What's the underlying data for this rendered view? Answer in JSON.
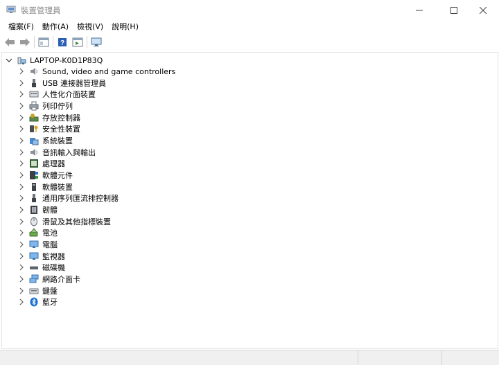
{
  "window": {
    "title": "裝置管理員"
  },
  "menu": [
    "檔案(F)",
    "動作(A)",
    "檢視(V)",
    "說明(H)"
  ],
  "toolbar": {
    "buttons": [
      "back-icon",
      "forward-icon",
      "properties-icon",
      "help-icon",
      "view-icon",
      "monitor-icon"
    ]
  },
  "tree": {
    "root": "LAPTOP-K0D1P83Q",
    "items": [
      {
        "label": "Sound, video and game controllers",
        "icon": "speaker-icon"
      },
      {
        "label": "USB 連接器管理員",
        "icon": "usb-icon"
      },
      {
        "label": "人性化介面裝置",
        "icon": "keyboard-hid-icon"
      },
      {
        "label": "列印佇列",
        "icon": "printer-icon"
      },
      {
        "label": "存放控制器",
        "icon": "storage-controller-icon"
      },
      {
        "label": "安全性裝置",
        "icon": "security-key-icon"
      },
      {
        "label": "系統裝置",
        "icon": "system-folder-icon"
      },
      {
        "label": "音訊輸入與輸出",
        "icon": "audio-icon"
      },
      {
        "label": "處理器",
        "icon": "processor-icon"
      },
      {
        "label": "軟體元件",
        "icon": "software-component-icon"
      },
      {
        "label": "軟體裝置",
        "icon": "software-device-icon"
      },
      {
        "label": "通用序列匯流排控制器",
        "icon": "usb-controller-icon"
      },
      {
        "label": "韌體",
        "icon": "firmware-icon"
      },
      {
        "label": "滑鼠及其他指標裝置",
        "icon": "mouse-icon"
      },
      {
        "label": "電池",
        "icon": "battery-icon"
      },
      {
        "label": "電腦",
        "icon": "computer-icon"
      },
      {
        "label": "監視器",
        "icon": "display-monitor-icon"
      },
      {
        "label": "磁碟機",
        "icon": "disk-drive-icon"
      },
      {
        "label": "網路介面卡",
        "icon": "network-adapter-icon"
      },
      {
        "label": "鍵盤",
        "icon": "keyboard-icon"
      },
      {
        "label": "藍牙",
        "icon": "bluetooth-icon"
      }
    ]
  },
  "colors": {
    "accent": "#2a7ad6",
    "bluetooth": "#1a6fd1"
  }
}
